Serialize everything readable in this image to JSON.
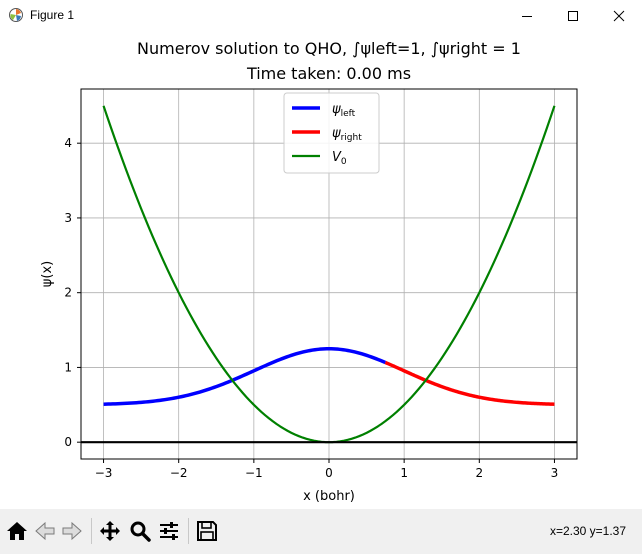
{
  "window": {
    "title": "Figure 1",
    "controls": [
      "minimize",
      "maximize",
      "close"
    ]
  },
  "figure": {
    "title_line1": "Numerov solution to QHO, ∫ψleft=1, ∫ψright = 1",
    "title_line2": "Time taken: 0.00 ms"
  },
  "chart_data": {
    "type": "line",
    "xlabel": "x (bohr)",
    "ylabel": "ψ(x)",
    "xlim": [
      -3.3,
      3.3
    ],
    "ylim": [
      -0.225,
      4.725
    ],
    "xticks": [
      -3,
      -2,
      -1,
      0,
      1,
      2,
      3
    ],
    "xtick_labels": [
      "−3",
      "−2",
      "−1",
      "0",
      "1",
      "2",
      "3"
    ],
    "yticks": [
      0,
      1,
      2,
      3,
      4
    ],
    "ytick_labels": [
      "0",
      "1",
      "2",
      "3",
      "4"
    ],
    "grid": true,
    "legend_position": "top-center",
    "series": [
      {
        "name": "ψleft",
        "color": "#0000ff",
        "x_range": [
          -3,
          0.75
        ],
        "formula": "0.5 + 0.75*exp(-x^2/2)"
      },
      {
        "name": "ψright",
        "color": "#ff0000",
        "x_range": [
          0.75,
          3
        ],
        "formula": "0.5 + 0.75*exp(-x^2/2)"
      },
      {
        "name": "V0",
        "color": "#008000",
        "x_range": [
          -3,
          3
        ],
        "formula": "0.5*x^2"
      }
    ],
    "baseline": {
      "y": 0,
      "color": "#000000"
    }
  },
  "status": {
    "coords": "x=2.30 y=1.37"
  },
  "toolbar": {
    "icons": [
      "home-icon",
      "back-arrow-icon",
      "forward-arrow-icon",
      "pan-icon",
      "zoom-icon",
      "configure-subplots-icon",
      "save-icon"
    ]
  }
}
